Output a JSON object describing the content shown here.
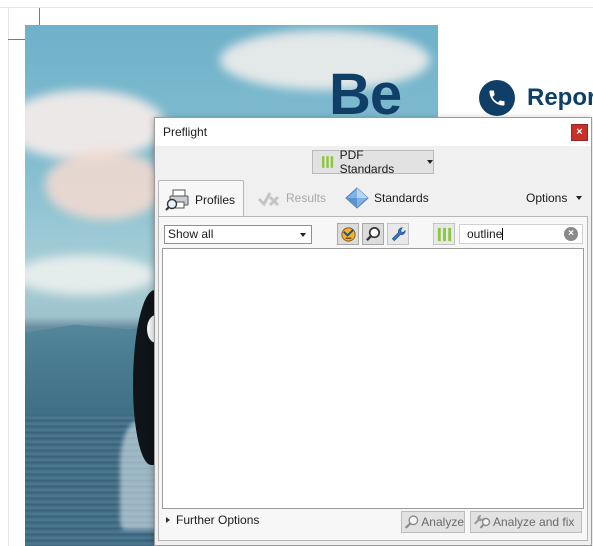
{
  "document": {
    "heading_partial": "Be",
    "report_label": "Report"
  },
  "dialog": {
    "title": "Preflight",
    "close_label": "×",
    "standards_dropdown_label": "PDF Standards",
    "tabs": {
      "profiles": "Profiles",
      "results": "Results",
      "standards": "Standards"
    },
    "options_label": "Options",
    "filter": {
      "selected": "Show all"
    },
    "search": {
      "value": "outline",
      "clear_label": "×"
    },
    "further_options_label": "Further Options",
    "analyze_label": "Analyze",
    "analyze_fix_label": "Analyze and fix"
  },
  "colors": {
    "accent_blue": "#0f3f66",
    "close_red": "#c8312a",
    "standards_green": "#8cc63f"
  },
  "icons": {
    "profiles": "printer-magnifier-icon",
    "results": "results-icon",
    "standards": "diamond-icon",
    "tool1": "badge-fix-icon",
    "tool2": "magnifier-icon",
    "tool3": "wrench-icon",
    "standards_filter": "green-bars-icon"
  }
}
